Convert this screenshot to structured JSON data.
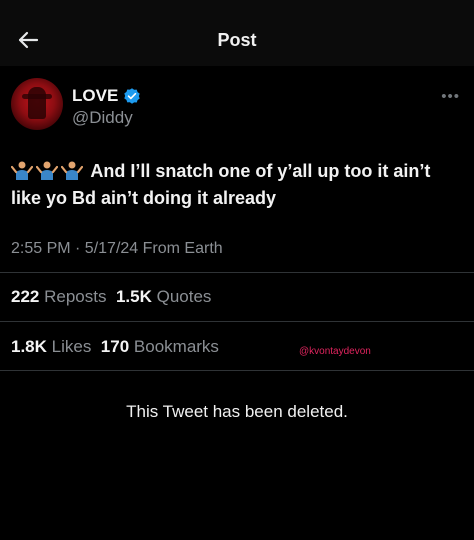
{
  "header": {
    "title": "Post"
  },
  "author": {
    "name": "LOVE",
    "handle": "@Diddy"
  },
  "tweet": {
    "emoji_icons": [
      "person-shrugging-icon",
      "person-shrugging-icon",
      "person-shrugging-icon"
    ],
    "text": "And I’ll snatch one of y’all up too it ain’t like yo Bd ain’t doing it already"
  },
  "meta": {
    "time_date": "2:55 PM · 5/17/24",
    "source": "From Earth"
  },
  "stats": {
    "reposts_count": "222",
    "reposts_label": "Reposts",
    "quotes_count": "1.5K",
    "quotes_label": "Quotes",
    "likes_count": "1.8K",
    "likes_label": "Likes",
    "bookmarks_count": "170",
    "bookmarks_label": "Bookmarks"
  },
  "watermark": "@kvontaydevon",
  "deleted_notice": "This Tweet has been deleted.",
  "colors": {
    "background": "#000000",
    "verified": "#1d9bf0",
    "watermark": "#e0245e",
    "muted": "#8b8f94"
  }
}
